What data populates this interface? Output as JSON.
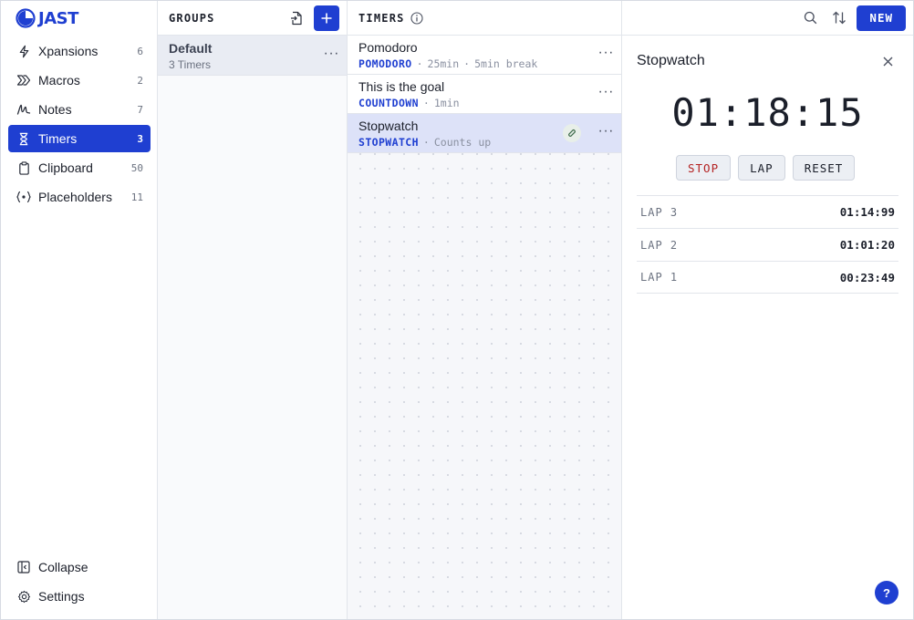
{
  "app": {
    "logo_text": "JAST"
  },
  "sidebar": {
    "items": [
      {
        "label": "Xpansions",
        "count": "6",
        "icon": "bolt-icon"
      },
      {
        "label": "Macros",
        "count": "2",
        "icon": "chevrons-right-icon"
      },
      {
        "label": "Notes",
        "count": "7",
        "icon": "scribble-icon"
      },
      {
        "label": "Timers",
        "count": "3",
        "icon": "hourglass-icon",
        "active": true
      },
      {
        "label": "Clipboard",
        "count": "50",
        "icon": "clipboard-icon"
      },
      {
        "label": "Placeholders",
        "count": "11",
        "icon": "braces-icon"
      }
    ],
    "collapse_label": "Collapse",
    "settings_label": "Settings"
  },
  "groups": {
    "title": "GROUPS",
    "items": [
      {
        "name": "Default",
        "sub": "3 Timers"
      }
    ]
  },
  "timers": {
    "title": "TIMERS",
    "new_label": "NEW",
    "items": [
      {
        "name": "Pomodoro",
        "type": "POMODORO",
        "meta1": "25min",
        "meta2": "5min break"
      },
      {
        "name": "This is the goal",
        "type": "COUNTDOWN",
        "meta1": "1min"
      },
      {
        "name": "Stopwatch",
        "type": "STOPWATCH",
        "meta1": "Counts up",
        "selected": true,
        "running": true
      }
    ]
  },
  "detail": {
    "title": "Stopwatch",
    "time": "01:18:15",
    "buttons": {
      "stop": "STOP",
      "lap": "LAP",
      "reset": "RESET"
    },
    "laps": [
      {
        "label": "LAP 3",
        "time": "01:14:99"
      },
      {
        "label": "LAP 2",
        "time": "01:01:20"
      },
      {
        "label": "LAP 1",
        "time": "00:23:49"
      }
    ],
    "help_label": "?"
  },
  "colors": {
    "accent": "#1f3fd1",
    "stop": "#b42323"
  }
}
